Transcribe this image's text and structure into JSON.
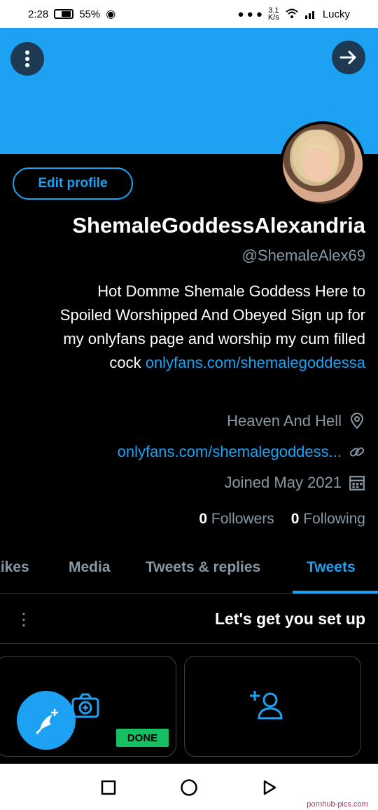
{
  "status_bar": {
    "time": "2:28",
    "battery": "55%",
    "carrier": "Lucky",
    "speed_value": "3.1",
    "speed_unit": "K/s",
    "icons": [
      "eye-icon",
      "battery-icon",
      "wifi-icon",
      "signal-icon",
      "notification-icon"
    ]
  },
  "header": {
    "banner_color": "#1da1f2",
    "more_icon": "more-vertical-icon",
    "next_icon": "arrow-right-icon"
  },
  "profile": {
    "edit_label": "Edit profile",
    "display_name": "ShemaleGoddessAlexandria",
    "handle": "@ShemaleAlex69",
    "bio_text": "Hot Domme Shemale Goddess Here to Spoiled Worshipped And Obeyed Sign up for my onlyfans page and worship my cum filled cock",
    "bio_link": "onlyfans.com/shemalegoddessa",
    "location": "Heaven And Hell",
    "url": "onlyfans.com/shemalegoddess...",
    "joined": "Joined May 2021",
    "following_count": "0",
    "following_label": "Following",
    "followers_count": "0",
    "followers_label": "Followers"
  },
  "tabs": {
    "items": [
      "Tweets",
      "Tweets & replies",
      "Media",
      "Likes"
    ],
    "active": "Tweets",
    "accent": "#1da1f2"
  },
  "setup": {
    "title": "Let's get you set up",
    "done_label": "DONE"
  },
  "nav_bar": {
    "icons": [
      "back-icon",
      "home-icon",
      "recents-icon"
    ]
  },
  "watermark": "pornhub-pics.com"
}
